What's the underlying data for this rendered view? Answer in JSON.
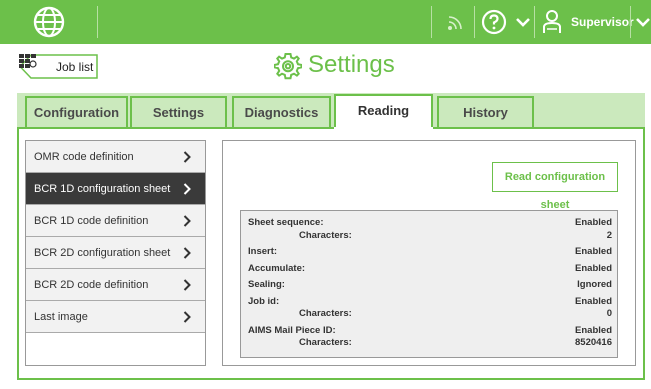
{
  "topbar": {
    "user_name": "Supervisor",
    "icons": [
      "globe-icon",
      "wifi-icon",
      "help-icon",
      "chevron-down-icon",
      "user-icon",
      "chevron-down-icon"
    ],
    "accent": "#6cc04a"
  },
  "header": {
    "job_list_label": "Job list",
    "title": "Settings"
  },
  "tabs": [
    {
      "label": "Configuration"
    },
    {
      "label": "Settings"
    },
    {
      "label": "Diagnostics"
    },
    {
      "label": "Reading",
      "active": true
    },
    {
      "label": "History"
    }
  ],
  "sidebar": {
    "items": [
      {
        "label": "OMR code definition"
      },
      {
        "label": "BCR 1D configuration sheet",
        "selected": true
      },
      {
        "label": "BCR 1D code definition"
      },
      {
        "label": "BCR 2D configuration sheet"
      },
      {
        "label": "BCR 2D code definition"
      },
      {
        "label": "Last image"
      }
    ]
  },
  "panel": {
    "read_button_label": "Read configuration sheet",
    "rows": [
      {
        "key": "Sheet sequence:",
        "value": "Enabled"
      },
      {
        "key": "Characters:",
        "value": "2",
        "indent": true
      },
      {
        "key": "Insert:",
        "value": "Enabled"
      },
      {
        "key": "Accumulate:",
        "value": "Enabled"
      },
      {
        "key": "Sealing:",
        "value": "Ignored"
      },
      {
        "key": "Job id:",
        "value": "Enabled"
      },
      {
        "key": "Characters:",
        "value": "0",
        "indent": true
      },
      {
        "key": "AIMS Mail Piece ID:",
        "value": "Enabled"
      },
      {
        "key": "Characters:",
        "value": "8520416",
        "indent": true
      }
    ]
  }
}
